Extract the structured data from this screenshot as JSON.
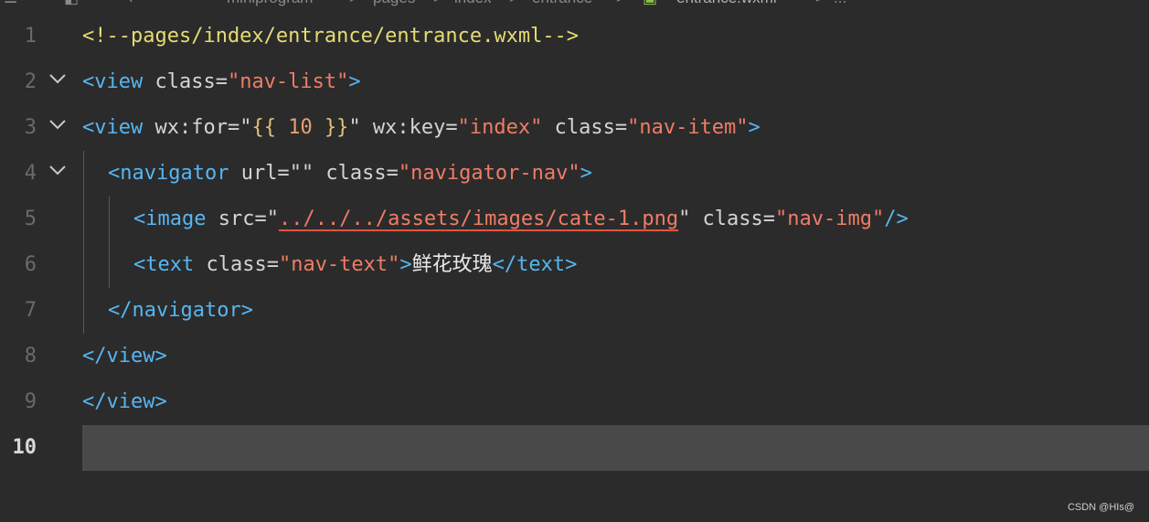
{
  "breadcrumb": {
    "items": [
      "miniprogram",
      "pages",
      "index",
      "entrance",
      "entrance.wxml",
      "..."
    ],
    "separator": ">"
  },
  "editor": {
    "line_numbers": [
      "1",
      "2",
      "3",
      "4",
      "5",
      "6",
      "7",
      "8",
      "9",
      "10"
    ],
    "active_line": "10",
    "lines": {
      "l1": {
        "comment": "<!--pages/index/entrance/entrance.wxml-->"
      },
      "l2": {
        "open": "<view",
        "sp1": " class=",
        "v1": "\"nav-list\"",
        "close": ">"
      },
      "l3": {
        "open": "<view",
        "a1": " wx:for=",
        "q1": "\"",
        "b1": "{{",
        "n1": " 10 ",
        "b2": "}}",
        "q2": "\"",
        "a2": " wx:key=",
        "v2": "\"index\"",
        "a3": " class=",
        "v3": "\"nav-item\"",
        "close": ">"
      },
      "l4": {
        "open": "<navigator",
        "a1": " url=",
        "v1": "\"\"",
        "a2": " class=",
        "v2": "\"navigator-nav\"",
        "close": ">"
      },
      "l5": {
        "open": "<image",
        "a1": " src=",
        "q1": "\"",
        "v1": "../../../assets/images/cate-1.png",
        "q2": "\"",
        "a2": " class=",
        "v2": "\"nav-img\"",
        "close": "/>"
      },
      "l6": {
        "open": "<text",
        "a1": " class=",
        "v1": "\"nav-text\"",
        "gt": ">",
        "text": "鲜花玫瑰",
        "close": "</text>"
      },
      "l7": {
        "close": "</navigator>"
      },
      "l8": {
        "close": "</view>"
      },
      "l9": {
        "close": "</view>"
      }
    }
  },
  "watermark": "CSDN @HIs@",
  "icons": {
    "fold": "chevron-down-icon",
    "file": "wxml-file-icon"
  },
  "colors": {
    "background": "#2b2b2b",
    "active_line": "#494949",
    "tag": "#56b6f2",
    "string": "#f07c66",
    "comment": "#e6db74"
  }
}
